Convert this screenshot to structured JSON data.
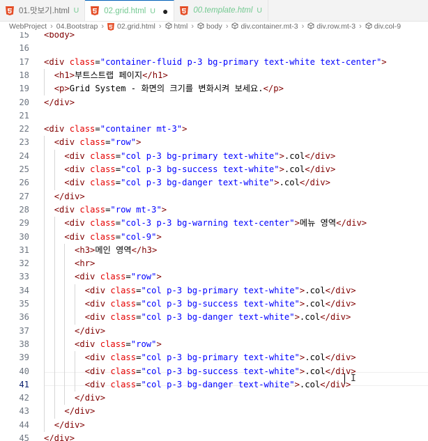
{
  "tabs": [
    {
      "name": "01.맛보기.html",
      "status": "U",
      "active": false,
      "italic": false,
      "dirty": false
    },
    {
      "name": "02.grid.html",
      "status": "U",
      "active": true,
      "italic": false,
      "dirty": true
    },
    {
      "name": "00.template.html",
      "status": "U",
      "active": false,
      "italic": true,
      "dirty": false
    }
  ],
  "breadcrumb": [
    {
      "label": "WebProject",
      "icon": ""
    },
    {
      "label": "04.Bootstrap",
      "icon": ""
    },
    {
      "label": "02.grid.html",
      "icon": "html5-icon"
    },
    {
      "label": "html",
      "icon": "cube-icon"
    },
    {
      "label": "body",
      "icon": "cube-icon"
    },
    {
      "label": "div.container.mt-3",
      "icon": "cube-icon"
    },
    {
      "label": "div.row.mt-3",
      "icon": "cube-icon"
    },
    {
      "label": "div.col-9",
      "icon": "cube-icon"
    }
  ],
  "editor": {
    "current_line": 41,
    "lines": [
      {
        "n": 15,
        "code": "<body>"
      },
      {
        "n": 16,
        "code": ""
      },
      {
        "n": 17,
        "code": "<div class=\"container-fluid p-3 bg-primary text-white text-center\">"
      },
      {
        "n": 18,
        "code": "  <h1>부트스트랩 페이지</h1>"
      },
      {
        "n": 19,
        "code": "  <p>Grid System - 화면의 크기를 변화시켜 보세요.</p>"
      },
      {
        "n": 20,
        "code": "</div>"
      },
      {
        "n": 21,
        "code": ""
      },
      {
        "n": 22,
        "code": "<div class=\"container mt-3\">"
      },
      {
        "n": 23,
        "code": "  <div class=\"row\">"
      },
      {
        "n": 24,
        "code": "    <div class=\"col p-3 bg-primary text-white\">.col</div>"
      },
      {
        "n": 25,
        "code": "    <div class=\"col p-3 bg-success text-white\">.col</div>"
      },
      {
        "n": 26,
        "code": "    <div class=\"col p-3 bg-danger text-white\">.col</div>"
      },
      {
        "n": 27,
        "code": "  </div>"
      },
      {
        "n": 28,
        "code": "  <div class=\"row mt-3\">"
      },
      {
        "n": 29,
        "code": "    <div class=\"col-3 p-3 bg-warning text-center\">메뉴 영역</div>"
      },
      {
        "n": 30,
        "code": "    <div class=\"col-9\">"
      },
      {
        "n": 31,
        "code": "      <h3>메인 영역</h3>"
      },
      {
        "n": 32,
        "code": "      <hr>"
      },
      {
        "n": 33,
        "code": "      <div class=\"row\">"
      },
      {
        "n": 34,
        "code": "        <div class=\"col p-3 bg-primary text-white\">.col</div>"
      },
      {
        "n": 35,
        "code": "        <div class=\"col p-3 bg-success text-white\">.col</div>"
      },
      {
        "n": 36,
        "code": "        <div class=\"col p-3 bg-danger text-white\">.col</div>"
      },
      {
        "n": 37,
        "code": "      </div>"
      },
      {
        "n": 38,
        "code": "      <div class=\"row\">"
      },
      {
        "n": 39,
        "code": "        <div class=\"col p-3 bg-primary text-white\">.col</div>"
      },
      {
        "n": 40,
        "code": "        <div class=\"col p-3 bg-success text-white\">.col</div>"
      },
      {
        "n": 41,
        "code": "        <div class=\"col p-3 bg-danger text-white\">.col</div>"
      },
      {
        "n": 42,
        "code": "      </div>"
      },
      {
        "n": 43,
        "code": "    </div>"
      },
      {
        "n": 44,
        "code": "  </div>"
      },
      {
        "n": 45,
        "code": "</div>"
      }
    ]
  },
  "colors": {
    "tag": "#800000",
    "attribute": "#e50000",
    "string": "#0000ff",
    "text": "#000000",
    "line_number": "#6e7681",
    "tab_active_border": "#005fb8",
    "html_icon": "#e44d26",
    "untracked": "#73c991"
  }
}
